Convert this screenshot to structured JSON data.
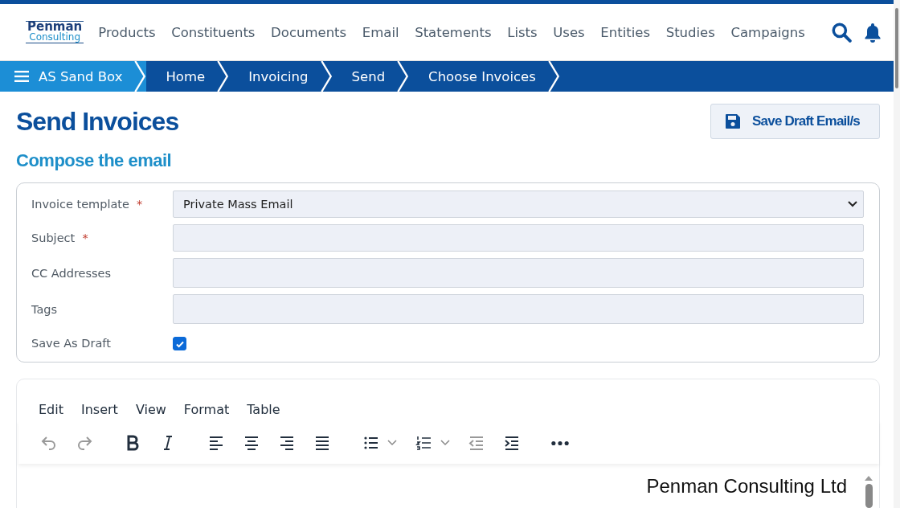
{
  "logo": {
    "line1": "Penman",
    "line2": "Consulting"
  },
  "nav": [
    "Products",
    "Constituents",
    "Documents",
    "Email",
    "Statements",
    "Lists",
    "Uses",
    "Entities",
    "Studies",
    "Campaigns"
  ],
  "breadcrumb": [
    {
      "label": "AS Sand Box",
      "kind": "root"
    },
    {
      "label": "Home",
      "kind": "crumb"
    },
    {
      "label": "Invoicing",
      "kind": "crumb"
    },
    {
      "label": "Send",
      "kind": "crumb"
    },
    {
      "label": "Choose Invoices",
      "kind": "crumb"
    }
  ],
  "page_title": "Send Invoices",
  "save_button": "Save Draft Email/s",
  "section_title": "Compose the email",
  "form": [
    {
      "label": "Invoice template",
      "required": true,
      "kind": "select",
      "value": "Private Mass Email"
    },
    {
      "label": "Subject",
      "required": true,
      "kind": "text"
    },
    {
      "label": "CC Addresses",
      "required": false,
      "kind": "text"
    },
    {
      "label": "Tags",
      "required": false,
      "kind": "text"
    },
    {
      "label": "Save As Draft",
      "required": false,
      "kind": "checkbox",
      "checked": true
    }
  ],
  "required_mark": "*",
  "editor": {
    "menu": [
      "Edit",
      "Insert",
      "View",
      "Format",
      "Table"
    ],
    "toolbar": [
      [
        {
          "kind": "undo",
          "disabled": true,
          "dropdown": false
        },
        {
          "kind": "redo",
          "disabled": true,
          "dropdown": false
        }
      ],
      [
        {
          "kind": "bold",
          "disabled": false,
          "dropdown": false
        },
        {
          "kind": "italic",
          "disabled": false,
          "dropdown": false
        }
      ],
      [
        {
          "kind": "align-left",
          "disabled": false,
          "dropdown": false
        },
        {
          "kind": "align-center",
          "disabled": false,
          "dropdown": false
        },
        {
          "kind": "align-right",
          "disabled": false,
          "dropdown": false
        },
        {
          "kind": "justify",
          "disabled": false,
          "dropdown": false
        }
      ],
      [
        {
          "kind": "bullet-list",
          "disabled": false,
          "dropdown": true
        },
        {
          "kind": "numbered-list",
          "disabled": false,
          "dropdown": true
        },
        {
          "kind": "outdent",
          "disabled": true,
          "dropdown": false
        },
        {
          "kind": "indent",
          "disabled": false,
          "dropdown": false
        }
      ],
      [
        {
          "kind": "more",
          "disabled": false,
          "dropdown": false
        }
      ]
    ],
    "content": "Penman Consulting Ltd"
  }
}
